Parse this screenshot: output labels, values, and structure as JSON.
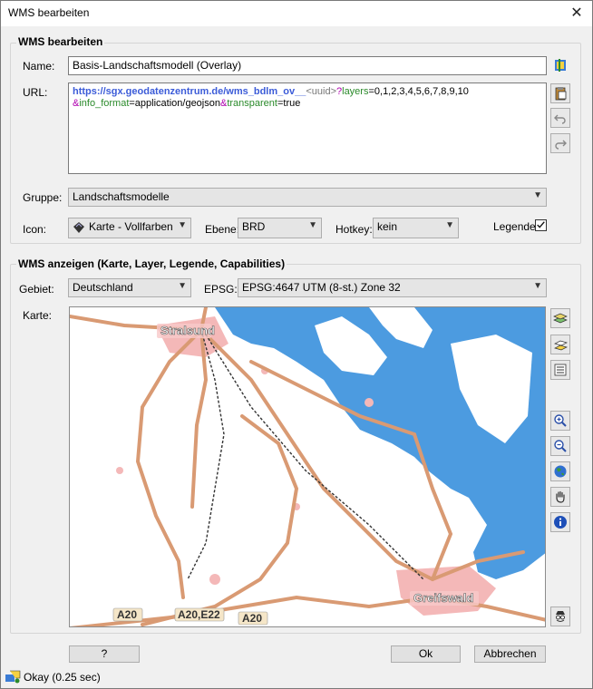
{
  "window": {
    "title": "WMS bearbeiten",
    "close": "✕"
  },
  "edit_group": {
    "title": "WMS bearbeiten",
    "name_label": "Name:",
    "name_value": "Basis-Landschaftsmodell (Overlay)",
    "url_label": "URL:",
    "url": {
      "p1": "https://sgx.geodatenzentrum.de/wms_bdlm_ov__",
      "p2": "<uuid>",
      "p3": "?",
      "p4": "layers",
      "p5": "=0,1,2,3,4,5,6,7,8,9,10",
      "p6": "&",
      "p7": "info_format",
      "p8": "=application/geojson",
      "p9": "&",
      "p10": "transparent",
      "p11": "=true"
    },
    "group_label": "Gruppe:",
    "group_value": "Landschaftsmodelle",
    "icon_label": "Icon:",
    "icon_value": "Karte - Vollfarben",
    "layer_label": "Ebene:",
    "layer_value": "BRD",
    "hotkey_label": "Hotkey:",
    "hotkey_value": "kein",
    "legend_label": "Legende",
    "legend_checked": true
  },
  "show_group": {
    "title": "WMS anzeigen (Karte, Layer, Legende, Capabilities)",
    "area_label": "Gebiet:",
    "area_value": "Deutschland",
    "epsg_label": "EPSG:",
    "epsg_value": "EPSG:4647 UTM (8-st.) Zone 32",
    "map_label": "Karte:"
  },
  "map": {
    "labels": {
      "stralsund": "Stralsund",
      "greifswald": "Greifswald",
      "a20_left": "A20",
      "a20_e22": "A20,E22",
      "a20_right": "A20"
    },
    "colors": {
      "water": "#4c9be0",
      "road": "#d99a73",
      "town": "#f4b8b8",
      "background": "#ffffff"
    }
  },
  "buttons": {
    "help": "?",
    "ok": "Ok",
    "cancel": "Abbrechen"
  },
  "status": {
    "text": "Okay (0.25 sec)"
  }
}
